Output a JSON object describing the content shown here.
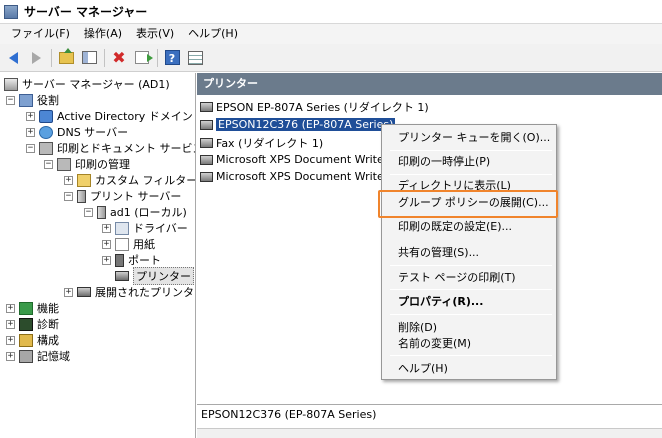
{
  "window": {
    "title": "サーバー マネージャー",
    "icon": "server-manager-icon"
  },
  "menubar": {
    "items": [
      "ファイル(F)",
      "操作(A)",
      "表示(V)",
      "ヘルプ(H)"
    ]
  },
  "toolbar": {
    "icons": [
      "back-icon",
      "forward-icon",
      "up-folder-icon",
      "show-hide-tree-icon",
      "delete-icon",
      "export-icon",
      "help-icon",
      "properties-icon"
    ]
  },
  "tree": {
    "root": "サーバー マネージャー (AD1)",
    "roles": "役割",
    "ad": "Active Directory ドメイン サ",
    "dns": "DNS サーバー",
    "print_services": "印刷とドキュメント サービス",
    "print_management": "印刷の管理",
    "custom_filters": "カスタム フィルター",
    "print_servers": "プリント サーバー",
    "server_local": "ad1 (ローカル)",
    "drivers": "ドライバー",
    "forms": "用紙",
    "ports": "ポート",
    "printers": "プリンター",
    "deployed_printers": "展開されたプリンター",
    "features": "機能",
    "diagnostics": "診断",
    "configuration": "構成",
    "storage": "記憶域"
  },
  "content": {
    "header": "プリンター",
    "printers": [
      "EPSON EP-807A Series (リダイレクト 1)",
      "EPSON12C376 (EP-807A Series)",
      "Fax (リダイレクト 1)",
      "Microsoft XPS Document Writer",
      "Microsoft XPS Document Writer"
    ],
    "status": "EPSON12C376 (EP-807A Series)"
  },
  "context_menu": {
    "items": [
      "プリンター キューを開く(O)...",
      "印刷の一時停止(P)",
      "ディレクトリに表示(L)",
      "グループ ポリシーの展開(C)...",
      "印刷の既定の設定(E)...",
      "共有の管理(S)...",
      "テスト ページの印刷(T)",
      "プロパティ(R)...",
      "削除(D)",
      "名前の変更(M)",
      "ヘルプ(H)"
    ]
  },
  "colors": {
    "header_bg": "#6b7b8c",
    "selection_bg": "#1f4e98",
    "highlight_outline": "#f0842c"
  }
}
